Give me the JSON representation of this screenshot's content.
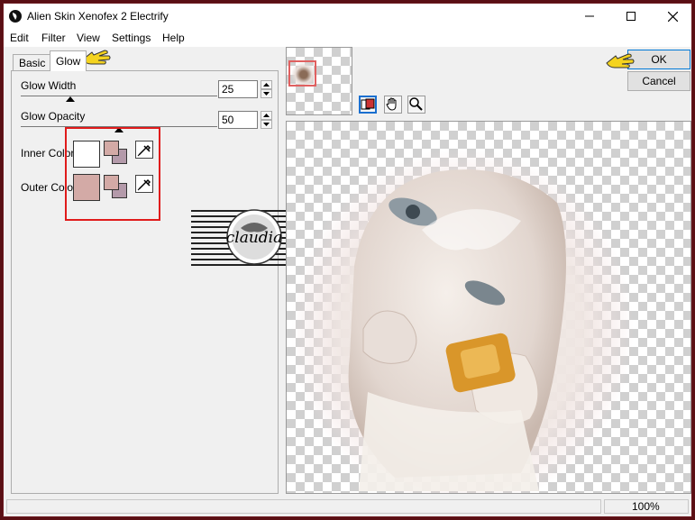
{
  "window": {
    "title": "Alien Skin Xenofex 2 Electrify"
  },
  "menu": [
    "Edit",
    "Filter",
    "View",
    "Settings",
    "Help"
  ],
  "tabs": [
    "Basic",
    "Glow"
  ],
  "glow": {
    "width_label": "Glow Width",
    "width_value": "25",
    "width_fraction": 0.25,
    "opacity_label": "Glow Opacity",
    "opacity_value": "50",
    "opacity_fraction": 0.5,
    "inner_color_label": "Inner Color",
    "outer_color_label": "Outer Color",
    "inner_color": "#ffffff",
    "outer_color": "#d3aaa6",
    "swap_color_a": "#d3aaa6",
    "swap_color_b": "#b49aaa"
  },
  "buttons": {
    "ok": "OK",
    "cancel": "Cancel"
  },
  "status": {
    "zoom": "100%"
  },
  "watermark": {
    "text": "claudia"
  },
  "colors": {
    "highlight": "#e01b1b",
    "pointer_hand": "#f4d31e",
    "frame": "#5a0f14"
  },
  "icons": [
    "app-icon",
    "minimize-icon",
    "maximize-icon",
    "close-icon",
    "eyedropper-icon",
    "preview-toggle-icon",
    "hand-tool-icon",
    "zoom-tool-icon",
    "pointing-hand-icon"
  ]
}
